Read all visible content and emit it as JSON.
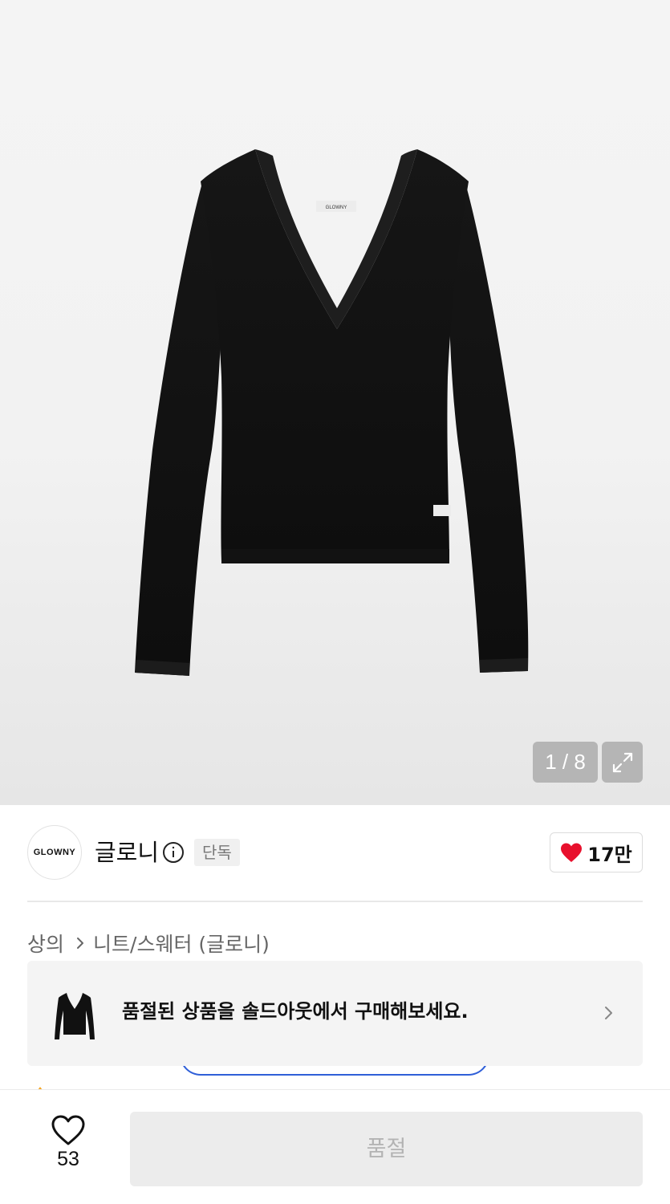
{
  "gallery": {
    "counter": "1 / 8",
    "garment_label": "GLOWNY"
  },
  "brand": {
    "logo_text": "GLOWNY",
    "name": "글로니",
    "badge": "단독",
    "likes": "17만"
  },
  "breadcrumb": {
    "category": "상의",
    "subcategory": "니트/스웨터 (글로니)"
  },
  "soldout_banner": {
    "text": "품절된 상품을 솔드아웃에서 구매해보세요."
  },
  "bottom_bar": {
    "wish_count": "53",
    "buy_label": "품절"
  },
  "colors": {
    "heart_red": "#e8102d",
    "peek_outline_blue": "#2f5fd8",
    "disabled_button": "#ececec"
  }
}
